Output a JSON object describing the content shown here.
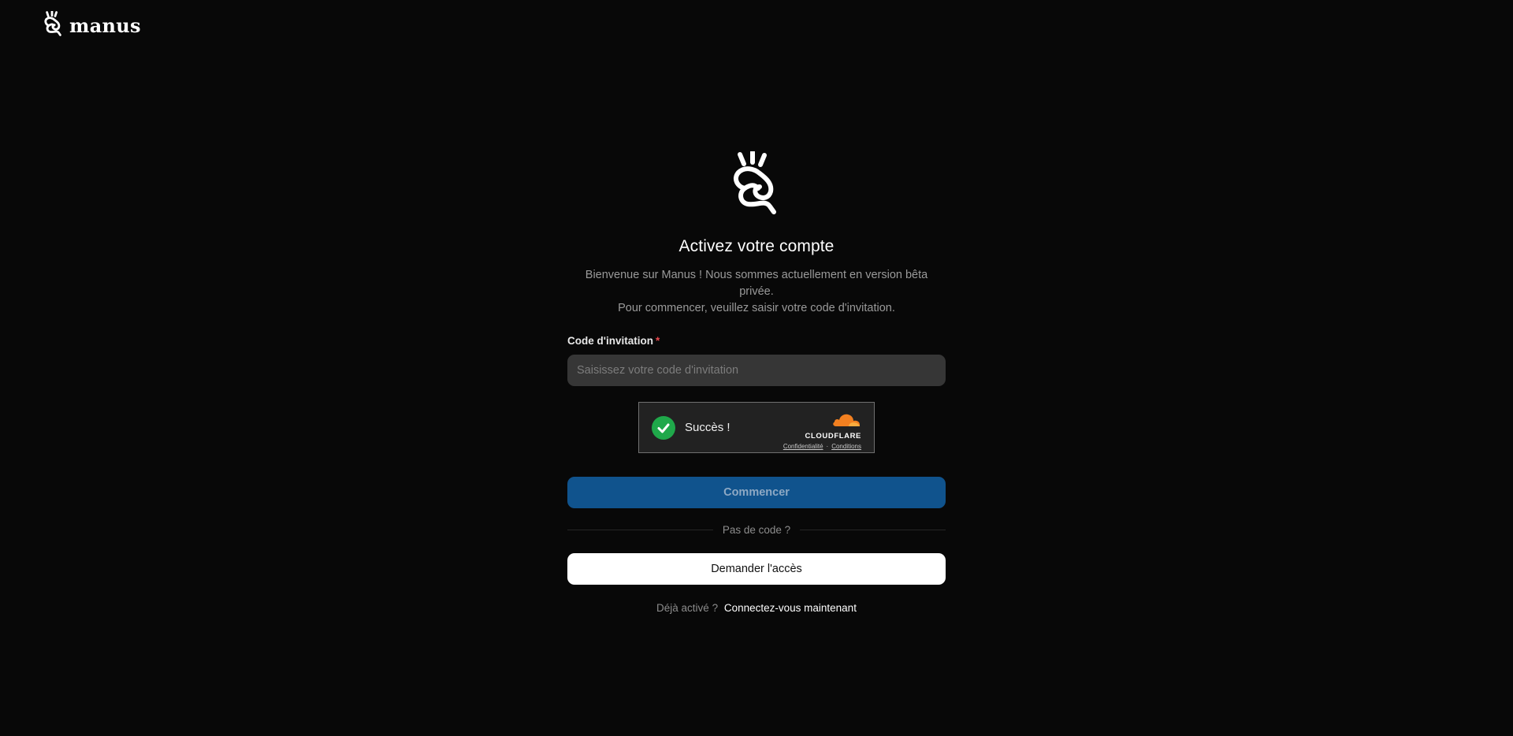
{
  "header": {
    "brand_name": "manus"
  },
  "main": {
    "title": "Activez votre compte",
    "subtitle_line1": "Bienvenue sur Manus ! Nous sommes actuellement en version bêta privée.",
    "subtitle_line2": "Pour commencer, veuillez saisir votre code d'invitation.",
    "invite_label": "Code d'invitation",
    "required_marker": "*",
    "invite_input_value": "",
    "invite_placeholder": "Saisissez votre code d'invitation",
    "captcha": {
      "status_text": "Succès !",
      "provider": "CLOUDFLARE",
      "privacy_link": "Confidentialité",
      "separator": "·",
      "terms_link": "Conditions",
      "check_color": "#1fa84a"
    },
    "start_button": "Commencer",
    "divider_text": "Pas de code ?",
    "request_access_button": "Demander l'accès",
    "already_active_text": "Déjà activé ?",
    "login_link": "Connectez-vous maintenant"
  },
  "colors": {
    "background": "#080808",
    "primary_button": "#10538d",
    "input_background": "#363636",
    "required": "#e5484d"
  },
  "icons": {
    "logo": "manus-hand-icon",
    "check": "check-icon",
    "cloud": "cloudflare-cloud-icon"
  }
}
